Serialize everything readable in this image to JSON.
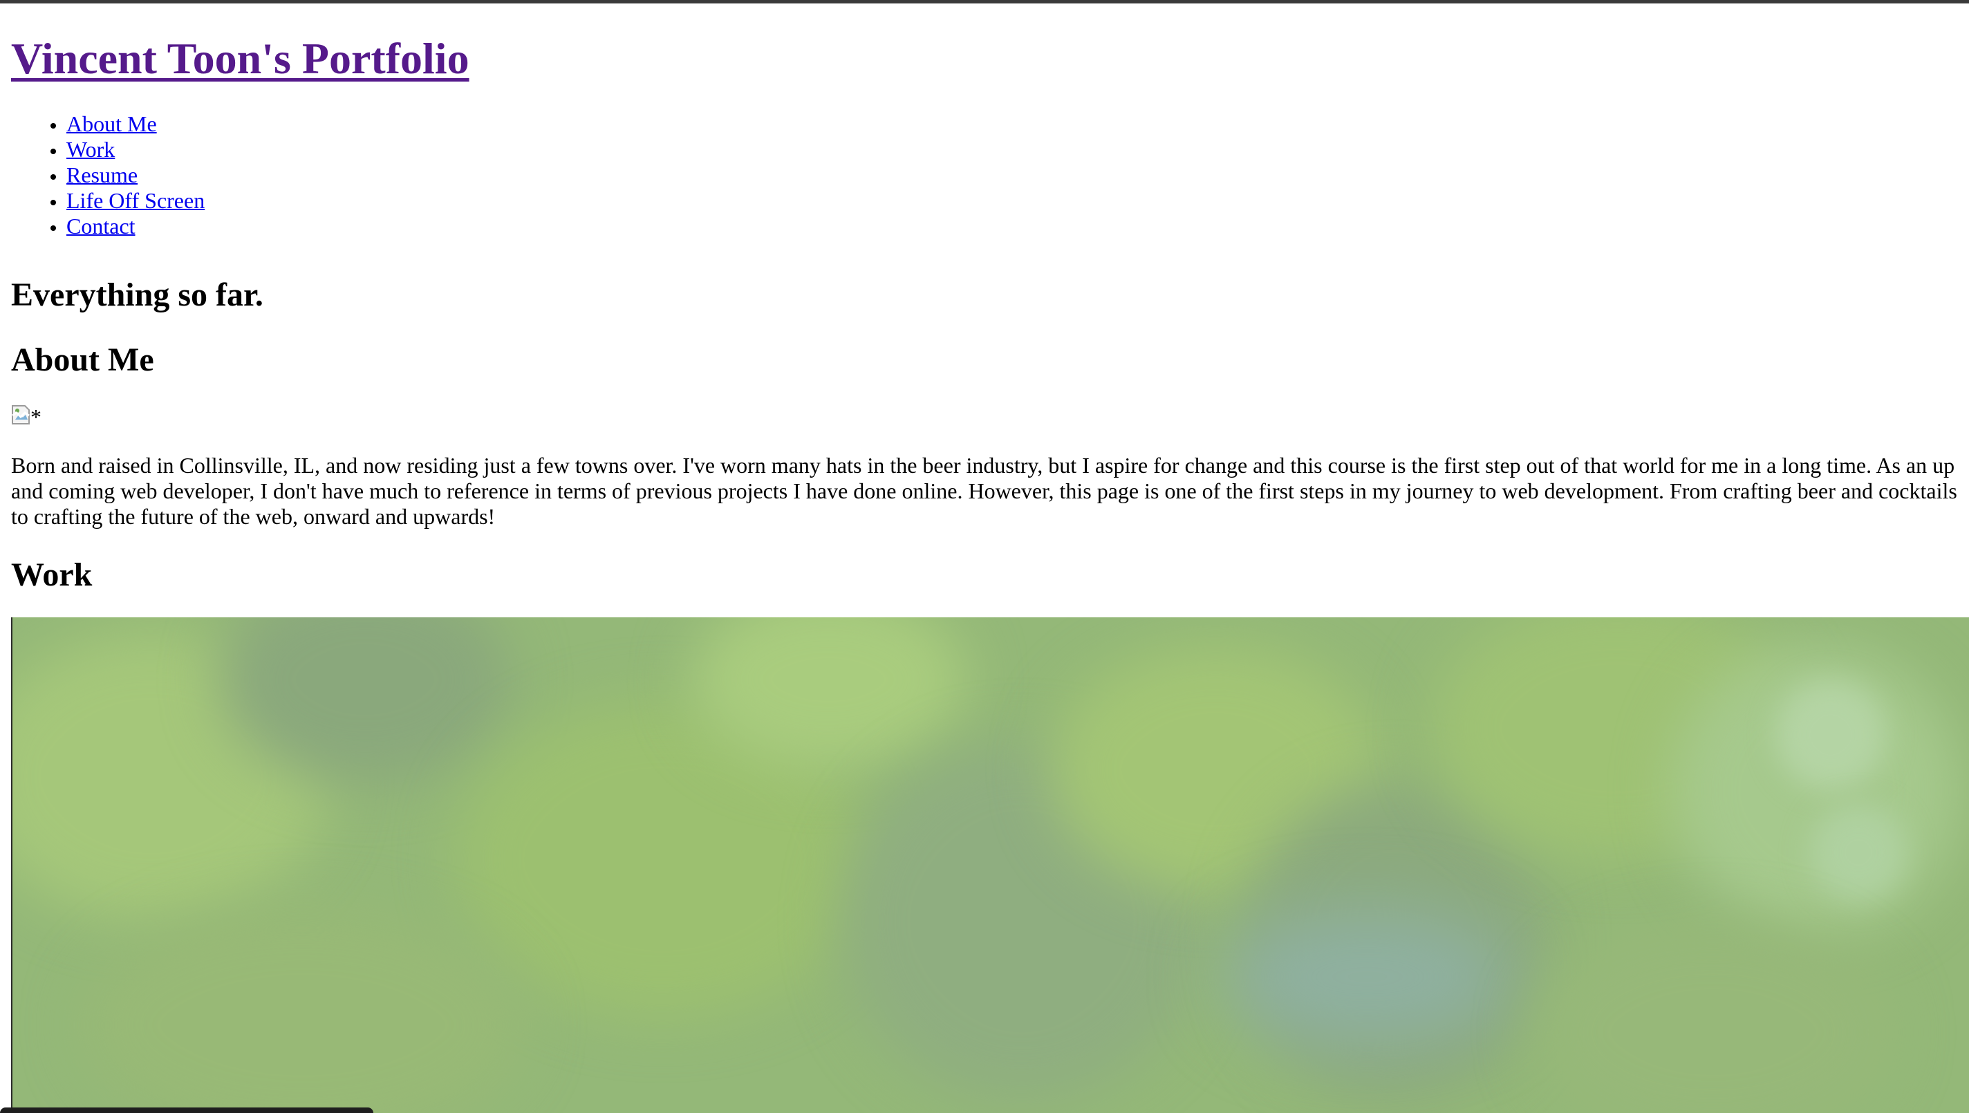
{
  "header": {
    "title": "Vincent Toon's Portfolio"
  },
  "nav": {
    "items": [
      {
        "label": "About Me"
      },
      {
        "label": "Work"
      },
      {
        "label": "Resume"
      },
      {
        "label": "Life Off Screen"
      },
      {
        "label": "Contact"
      }
    ]
  },
  "main": {
    "intro_heading": "Everything so far.",
    "about": {
      "heading": "About Me",
      "image_alt": "*",
      "text": "Born and raised in Collinsville, IL, and now residing just a few towns over. I've worn many hats in the beer industry, but I aspire for change and this course is the first step out of that world for me in a long time. As an up and coming web developer, I don't have much to reference in terms of previous projects I have done online. However, this page is one of the first steps in my journey to web development. From crafting beer and cocktails to crafting the future of the web, onward and upwards!"
    },
    "work": {
      "heading": "Work",
      "image_icon": "blurred-green-foliage-image"
    }
  },
  "colors": {
    "visited_link": "#551a8b",
    "link": "#0000ee",
    "image_green": "#94b878"
  }
}
